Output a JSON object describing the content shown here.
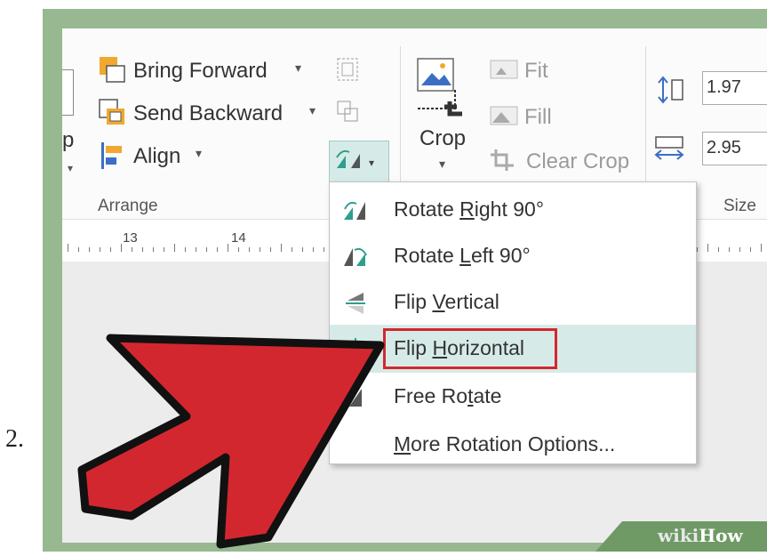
{
  "step_number": "2.",
  "ribbon": {
    "bring_forward": "Bring Forward",
    "send_backward": "Send Backward",
    "align": "Align",
    "arrange_group_label": "Arrange",
    "crop_label": "Crop",
    "fit": "Fit",
    "fill": "Fill",
    "clear_crop": "Clear Crop",
    "height_value": "1.97",
    "width_value": "2.95",
    "size_group_label": "Size",
    "left_cut_text": "p"
  },
  "ruler": {
    "marks": [
      "13",
      "14"
    ]
  },
  "rotate_menu": {
    "items": [
      {
        "pre": "Rotate ",
        "key": "R",
        "post": "ight 90°",
        "icon": "rotate-right-icon"
      },
      {
        "pre": "Rotate ",
        "key": "L",
        "post": "eft 90°",
        "icon": "rotate-left-icon"
      },
      {
        "pre": "Flip ",
        "key": "V",
        "post": "ertical",
        "icon": "flip-vertical-icon"
      },
      {
        "pre": "Flip ",
        "key": "H",
        "post": "orizontal",
        "icon": "flip-horizontal-icon"
      },
      {
        "pre": "Free Ro",
        "key": "t",
        "post": "ate",
        "icon": "free-rotate-icon"
      },
      {
        "pre": "",
        "key": "M",
        "post": "ore Rotation Options...",
        "icon": ""
      }
    ],
    "highlighted_index": 3
  },
  "watermark": {
    "brand_prefix": "wiki",
    "brand_suffix": "How"
  },
  "colors": {
    "highlight": "#d6ebe7",
    "callout_red": "#d3272f",
    "frame_green": "#97b890"
  }
}
